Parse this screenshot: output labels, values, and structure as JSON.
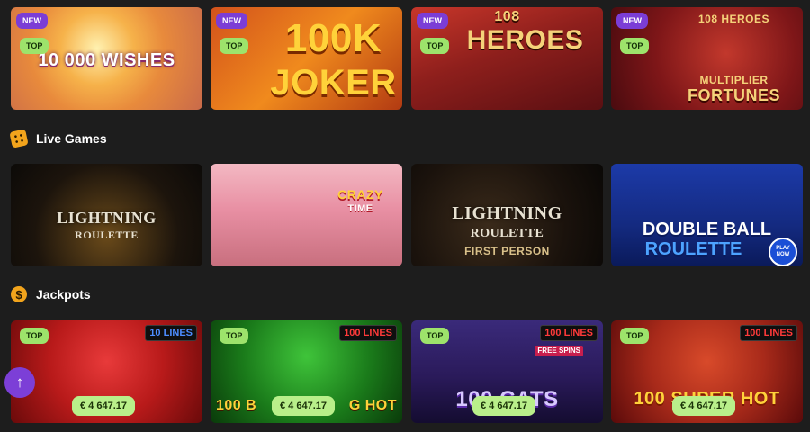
{
  "slots_row": [
    {
      "title_line1": "10 000",
      "title_line2": "WISHES",
      "badge_new": "NEW",
      "badge_top": "TOP"
    },
    {
      "title_line1": "100K",
      "title_line2": "JOKER",
      "badge_new": "NEW",
      "badge_top": "TOP"
    },
    {
      "title_line1": "108",
      "title_line2": "HEROES",
      "badge_new": "NEW",
      "badge_top": "TOP"
    },
    {
      "title_line1": "108 HEROES",
      "title_line2": "MULTIPLIER",
      "title_line3": "FORTUNES",
      "badge_new": "NEW",
      "badge_top": "TOP"
    }
  ],
  "live_games": {
    "title": "Live Games",
    "icon": "dice-icon",
    "tiles": [
      {
        "title_line1": "LIGHTNING",
        "title_line2": "ROULETTE"
      },
      {
        "title_line1": "CRAZY",
        "title_line2": "TIME"
      },
      {
        "title_line1": "LIGHTNING",
        "title_line2": "ROULETTE",
        "title_line3": "FIRST PERSON"
      },
      {
        "title_line1": "DOUBLE BALL",
        "title_line2": "ROULETTE",
        "play_now": "PLAY NOW"
      }
    ]
  },
  "jackpots": {
    "title": "Jackpots",
    "icon": "dollar-coin-icon",
    "coin_symbol": "$",
    "tiles": [
      {
        "lines": "10 LINES",
        "badge_top": "TOP",
        "amount": "€ 4 647.17"
      },
      {
        "lines": "100 LINES",
        "badge_top": "TOP",
        "amount": "€ 4 647.17",
        "title": "100 B",
        "title_end": "G HOT"
      },
      {
        "lines": "100 LINES",
        "badge_top": "TOP",
        "amount": "€ 4 647.17",
        "title": "100 CATS",
        "free_spins": "FREE SPINS"
      },
      {
        "lines": "100 LINES",
        "badge_top": "TOP",
        "amount": "€ 4 647.17",
        "title": "100 SUPER HOT"
      }
    ]
  },
  "scroll_top_label": "↑",
  "colors": {
    "background": "#1d1d1d",
    "badge_new": "#7b3dd6",
    "badge_top": "#9de36b",
    "jackpot_pill": "#b9ef8a",
    "accent_orange": "#f2a41c"
  }
}
